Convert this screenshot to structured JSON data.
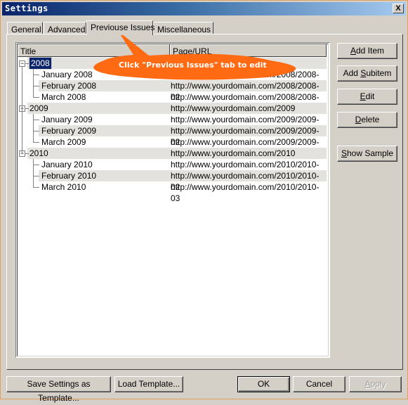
{
  "window": {
    "title": "Settings",
    "close_label": "X"
  },
  "tabs": [
    {
      "label": "General",
      "active": false
    },
    {
      "label": "Advanced",
      "active": false
    },
    {
      "label": "Previouse Issues",
      "active": true
    },
    {
      "label": "Miscellaneous",
      "active": false
    }
  ],
  "list": {
    "columns": [
      "Title",
      "Page/URL"
    ],
    "rows": [
      {
        "title": "2008",
        "url": "",
        "level": 0,
        "selected": true
      },
      {
        "title": "January 2008",
        "url": "http://www.yourdomain.com/2008/2008-01",
        "level": 1
      },
      {
        "title": "February 2008",
        "url": "http://www.yourdomain.com/2008/2008-02",
        "level": 1
      },
      {
        "title": "March 2008",
        "url": "http://www.yourdomain.com/2008/2008-02",
        "level": 1
      },
      {
        "title": "2009",
        "url": "http://www.yourdomain.com/2009",
        "level": 0
      },
      {
        "title": "January 2009",
        "url": "http://www.yourdomain.com/2009/2009-01",
        "level": 1
      },
      {
        "title": "February 2009",
        "url": "http://www.yourdomain.com/2009/2009-02",
        "level": 1
      },
      {
        "title": "March 2009",
        "url": "http://www.yourdomain.com/2009/2009-03",
        "level": 1
      },
      {
        "title": "2010",
        "url": "http://www.yourdomain.com/2010",
        "level": 0
      },
      {
        "title": "January 2010",
        "url": "http://www.yourdomain.com/2010/2010-01",
        "level": 1
      },
      {
        "title": "February 2010",
        "url": "http://www.yourdomain.com/2010/2010-02",
        "level": 1
      },
      {
        "title": "March 2010",
        "url": "http://www.yourdomain.com/2010/2010-03",
        "level": 1
      }
    ]
  },
  "side_buttons": {
    "add_item": {
      "pre": "",
      "key": "A",
      "post": "dd Item"
    },
    "add_subitem": {
      "pre": "Add ",
      "key": "S",
      "post": "ubitem"
    },
    "edit": {
      "pre": "",
      "key": "E",
      "post": "dit"
    },
    "delete": {
      "pre": "",
      "key": "D",
      "post": "elete"
    },
    "show_sample": {
      "pre": "",
      "key": "S",
      "post": "how Sample"
    }
  },
  "footer": {
    "save_template": "Save Settings as Template...",
    "load_template": "Load Template...",
    "ok": "OK",
    "cancel": "Cancel",
    "apply": {
      "key": "A",
      "post": "pply"
    }
  },
  "annotation": {
    "text": "Click \"Previous Issues\" tab to edit",
    "color": "#ff6a13"
  }
}
